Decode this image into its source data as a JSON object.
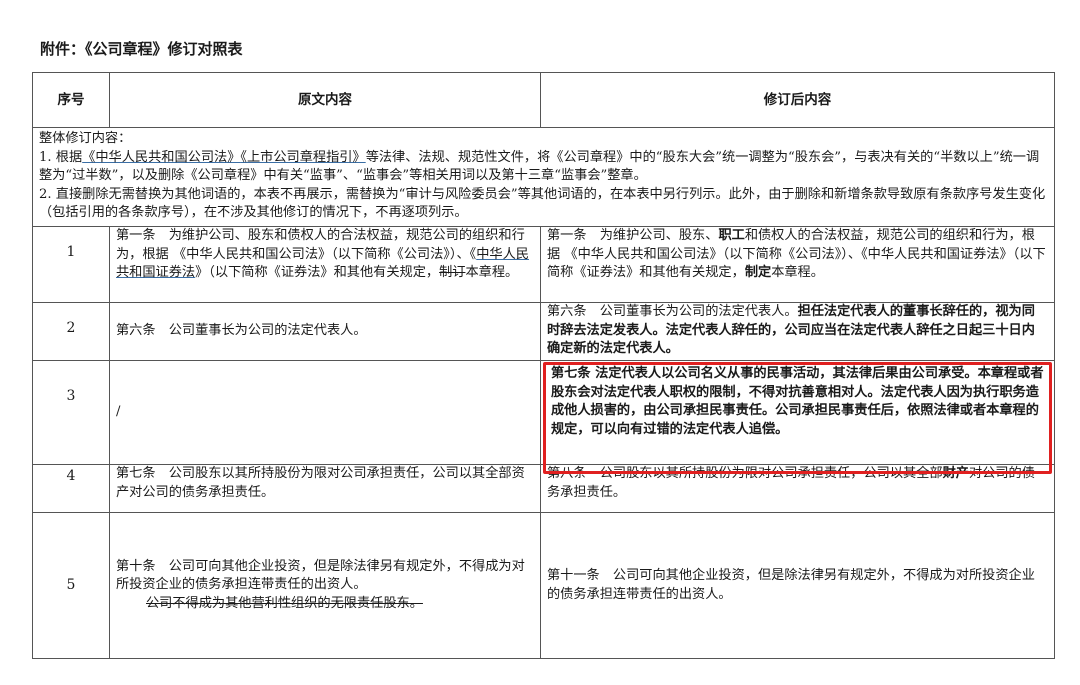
{
  "title": "附件：《公司章程》修订对照表",
  "headers": {
    "seq": "序号",
    "original": "原文内容",
    "revised": "修订后内容"
  },
  "overall": {
    "heading": "整体修订内容：",
    "item1_prefix": " 1. 根据",
    "item1_law1": "《中华人民共和国公司法》",
    "item1_law2": "《上市公司章程指引》",
    "item1_rest": "等法律、法规、规范性文件，将《公司章程》中的“股东大会”统一调整为“股东会”，与表决有关的“半数以上”统一调整为“过半数”，以及删除《公司章程》中有关“监事”、“监事会”等相关用词以及第十三章“监事会”整章。",
    "item2": " 2. 直接删除无需替换为其他词语的，本表不再展示，需替换为“审计与风险委员会”等其他词语的，在本表中另行列示。此外，由于删除和新增条款导致原有条款序号发生变化（包括引用的各条款序号），在不涉及其他修订的情况下，不再逐项列示。"
  },
  "rows": [
    {
      "num": "1",
      "orig_a": "第一条　为维护公司、股东和债权人的合法权益，规范公司的组织和行为，根据 《中华人民共和国公司法》（以下简称《公司法》）、《",
      "orig_law": "中华人民共和国证券法",
      "orig_b": "》（以下简称《证券法》和其他有关规定，",
      "orig_del": "制订",
      "orig_c": "本章程。",
      "rev_a": "第一条　为维护公司、股东、",
      "rev_bold1": "职工",
      "rev_b": "和债权人的合法权益，规范公司的组织和行为，根据 《中华人民共和国公司法》（以下简称《公司法》）、《中华人民共和国证券法》（以下简称《证券法》和其他有关规定，",
      "rev_bold2": "制定",
      "rev_c": "本章程。"
    },
    {
      "num": "2",
      "orig": "第六条　公司董事长为公司的法定代表人。",
      "rev_a": "第六条　公司董事长为公司的法定代表人。",
      "rev_bold": "担任法定代表人的董事长辞任的，视为同时辞去法定发表人。法定代表人辞任的，公司应当在法定代表人辞任之日起三十日内确定新的法定代表人。"
    },
    {
      "num": "3",
      "orig": "/",
      "rev_bold": "第七条 法定代表人以公司名义从事的民事活动，其法律后果由公司承受。本章程或者股东会对法定代表人职权的限制，不得对抗善意相对人。法定代表人因为执行职务造成他人损害的，由公司承担民事责任。公司承担民事责任后，依照法律或者本章程的规定，可以向有过错的法定代表人追偿。"
    },
    {
      "num": "4",
      "orig": "第七条　公司股东以其所持股份为限对公司承担责任，公司以其全部资产对公司的债务承担责任。",
      "rev_a": "第八条　公司股东以其所持股份为限对公司承担责任，公司以其全部",
      "rev_bold": "财产",
      "rev_b": "对公司的债务承担责任。"
    },
    {
      "num": "5",
      "orig_a": "第十条　公司可向其他企业投资，但是除法律另有规定外，不得成为对所投资企业的债务承担连带责任的出资人。",
      "orig_del": "公司不得成为其他营利性组织的无限责任股东。",
      "rev": "第十一条　公司可向其他企业投资，但是除法律另有规定外，不得成为对所投资企业的债务承担连带责任的出资人。"
    }
  ]
}
